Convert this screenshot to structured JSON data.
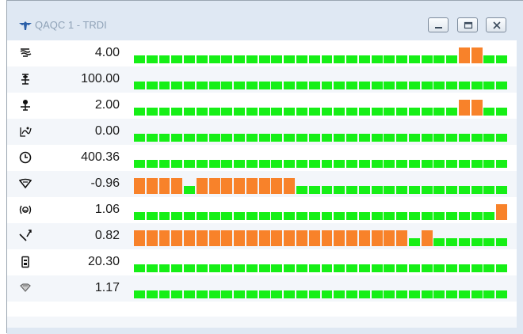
{
  "window": {
    "title": "QAQC 1 - TRDI",
    "app_icon": "teledyne-logo-icon",
    "controls": [
      "minimize-icon",
      "maximize-icon",
      "close-icon"
    ]
  },
  "colors": {
    "ok": "#16ef16",
    "warning": "#f8822a",
    "titlebar": "#dfe8f3",
    "title_text": "#8fa2b7"
  },
  "cells_per_row": 30,
  "rows": [
    {
      "id": "error-velocity",
      "icon": "wave-velocity-icon",
      "value": "4.00",
      "warn": [
        26,
        27
      ]
    },
    {
      "id": "percent-good",
      "icon": "beam-percent-icon",
      "value": "100.00",
      "warn": []
    },
    {
      "id": "beam-count",
      "icon": "beam-range-icon",
      "value": "2.00",
      "warn": [
        26,
        27
      ]
    },
    {
      "id": "correlation",
      "icon": "correlation-icon",
      "value": "0.00",
      "warn": []
    },
    {
      "id": "time",
      "icon": "clock-icon",
      "value": "400.36",
      "warn": []
    },
    {
      "id": "heading",
      "icon": "heading-icon",
      "value": "-0.96",
      "warn": [
        0,
        1,
        2,
        3,
        5,
        6,
        7,
        8,
        9,
        10,
        11,
        12
      ]
    },
    {
      "id": "pitch-roll",
      "icon": "tilt-icon",
      "value": "1.06",
      "warn": [
        29
      ]
    },
    {
      "id": "vertical-velocity",
      "icon": "compass-needle-icon",
      "value": "0.82",
      "warn": [
        0,
        1,
        2,
        3,
        4,
        5,
        6,
        7,
        8,
        9,
        10,
        11,
        12,
        13,
        14,
        15,
        16,
        17,
        18,
        19,
        20,
        21,
        23
      ]
    },
    {
      "id": "battery",
      "icon": "battery-icon",
      "value": "20.30",
      "warn": []
    },
    {
      "id": "depth",
      "icon": "transducer-icon",
      "value": "1.17",
      "warn": []
    }
  ]
}
